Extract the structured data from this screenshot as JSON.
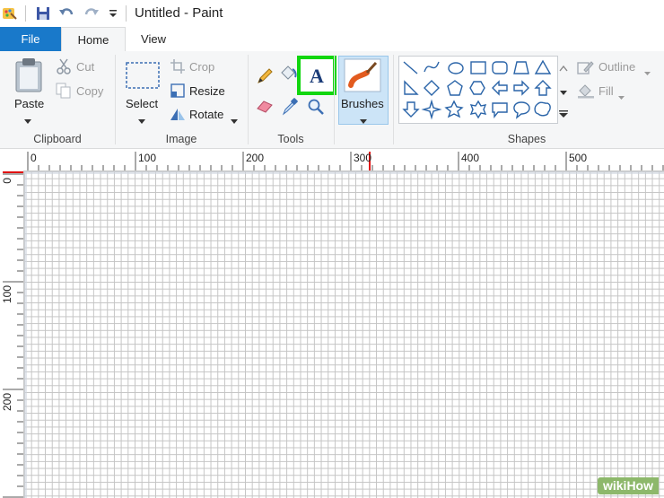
{
  "window": {
    "title": "Untitled - Paint"
  },
  "quick_access": [
    {
      "name": "app-menu-icon"
    },
    {
      "name": "save-icon"
    },
    {
      "name": "undo-icon"
    },
    {
      "name": "redo-icon"
    },
    {
      "name": "customize-toolbar-icon"
    }
  ],
  "tabs": [
    {
      "label": "File",
      "selected": false
    },
    {
      "label": "Home",
      "selected": true
    },
    {
      "label": "View",
      "selected": false
    }
  ],
  "clipboard": {
    "paste": "Paste",
    "cut": "Cut",
    "copy": "Copy",
    "label": "Clipboard"
  },
  "image": {
    "select": "Select",
    "crop": "Crop",
    "resize": "Resize",
    "rotate": "Rotate",
    "label": "Image"
  },
  "tools": {
    "label": "Tools",
    "highlighted": "text-tool",
    "highlight_color": "#11d60f"
  },
  "brushes": {
    "label": "Brushes"
  },
  "shapes": {
    "outline": "Outline",
    "fill": "Fill",
    "label": "Shapes"
  },
  "ruler": {
    "top_ticks": [
      "0",
      "100",
      "200",
      "300",
      "400",
      "500"
    ],
    "left_ticks": [
      "0",
      "100",
      "200"
    ],
    "marker_color": "#e01010"
  },
  "watermark": {
    "text": "wikiHow"
  }
}
